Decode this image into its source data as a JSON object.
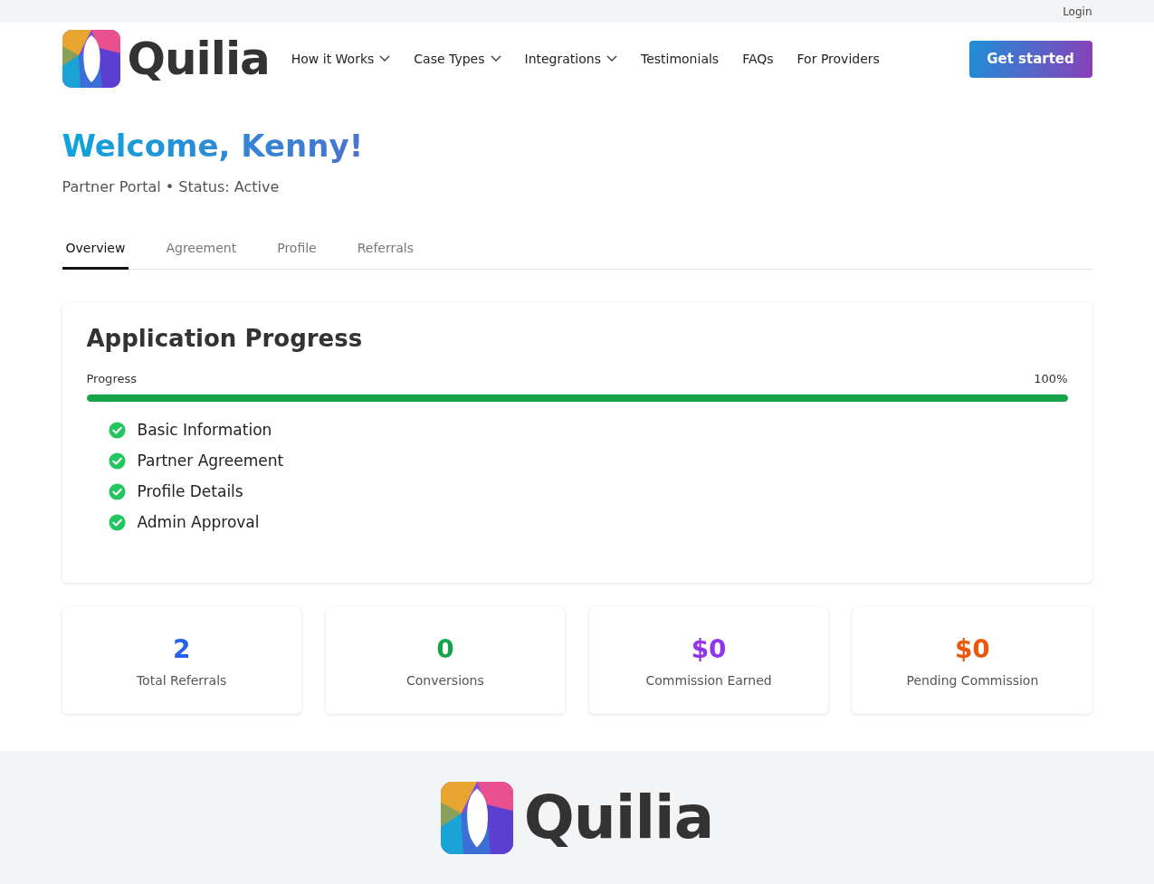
{
  "top_bar": {
    "login": "Login"
  },
  "header": {
    "logo_text": "Quilia",
    "nav": [
      {
        "label": "How it Works",
        "has_menu": true
      },
      {
        "label": "Case Types",
        "has_menu": true
      },
      {
        "label": "Integrations",
        "has_menu": true
      },
      {
        "label": "Testimonials",
        "has_menu": false
      },
      {
        "label": "FAQs",
        "has_menu": false
      },
      {
        "label": "For Providers",
        "has_menu": false
      }
    ],
    "cta": "Get started"
  },
  "welcome": {
    "title": "Welcome, Kenny!",
    "subtitle": "Partner Portal • Status: Active"
  },
  "tabs": [
    {
      "label": "Overview",
      "selected": true
    },
    {
      "label": "Agreement",
      "selected": false
    },
    {
      "label": "Profile",
      "selected": false
    },
    {
      "label": "Referrals",
      "selected": false
    }
  ],
  "progress_card": {
    "title": "Application Progress",
    "label": "Progress",
    "reading": "100%",
    "level": 1,
    "steps": [
      {
        "label": "Basic Information",
        "done": true
      },
      {
        "label": "Partner Agreement",
        "done": true
      },
      {
        "label": "Profile Details",
        "done": true
      },
      {
        "label": "Admin Approval",
        "done": true
      }
    ]
  },
  "stats": [
    {
      "value": "2",
      "label": "Total Referrals",
      "color": "#2563eb"
    },
    {
      "value": "0",
      "label": "Conversions",
      "color": "#16a34a"
    },
    {
      "value": "$0",
      "label": "Commission Earned",
      "color": "#9333ea"
    },
    {
      "value": "$0",
      "label": "Pending Commission",
      "color": "#ea580c"
    }
  ],
  "footer": {
    "logo_text": "Quilia"
  }
}
